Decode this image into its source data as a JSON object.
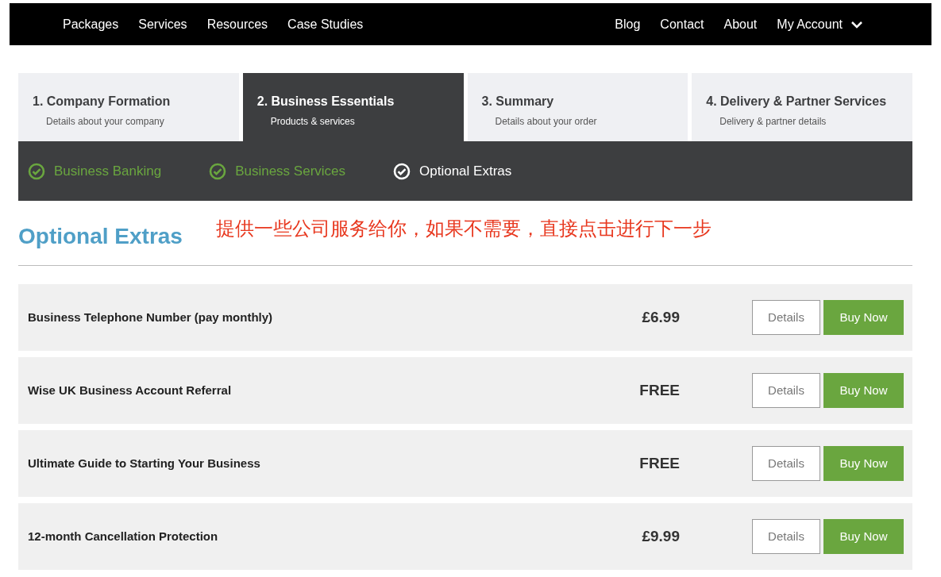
{
  "nav": {
    "left": [
      "Packages",
      "Services",
      "Resources",
      "Case Studies"
    ],
    "right": [
      "Blog",
      "Contact",
      "About"
    ],
    "account": "My Account"
  },
  "steps": [
    {
      "title": "1. Company Formation",
      "subtitle": "Details about your company",
      "selected": false
    },
    {
      "title": "2. Business Essentials",
      "subtitle": "Products & services",
      "selected": true
    },
    {
      "title": "3. Summary",
      "subtitle": "Details about your order",
      "selected": false
    },
    {
      "title": "4. Delivery & Partner Services",
      "subtitle": "Delivery & partner details",
      "selected": false
    }
  ],
  "substeps": [
    {
      "label": "Business Banking",
      "completed": true
    },
    {
      "label": "Business Services",
      "completed": true
    },
    {
      "label": "Optional Extras",
      "completed": false
    }
  ],
  "heading": "Optional Extras",
  "annotation": "提供一些公司服务给你，如果不需要，直接点击进行下一步",
  "products": [
    {
      "name": "Business Telephone Number (pay monthly)",
      "price": "£6.99",
      "details": "Details",
      "buy": "Buy Now"
    },
    {
      "name": "Wise UK Business Account Referral",
      "price": "FREE",
      "details": "Details",
      "buy": "Buy Now"
    },
    {
      "name": "Ultimate Guide to Starting Your Business",
      "price": "FREE",
      "details": "Details",
      "buy": "Buy Now"
    },
    {
      "name": "12-month Cancellation Protection",
      "price": "£9.99",
      "details": "Details",
      "buy": "Buy Now"
    }
  ]
}
